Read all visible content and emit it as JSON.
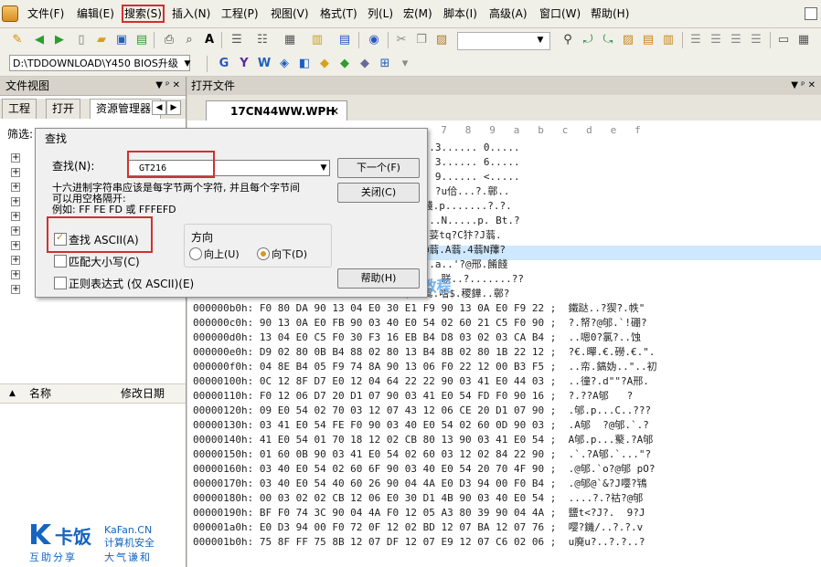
{
  "menubar": {
    "items": [
      "文件(F)",
      "编辑(E)",
      "搜索(S)",
      "插入(N)",
      "工程(P)",
      "视图(V)",
      "格式(T)",
      "列(L)",
      "宏(M)",
      "脚本(I)",
      "高级(A)",
      "窗口(W)",
      "帮助(H)"
    ]
  },
  "path": "D:\\TDDOWNLOAD\\Y450 BIOS升级",
  "left_pane": {
    "title": "文件视图",
    "pin": "▼ ᵖ ✕",
    "tabs": [
      "工程",
      "打开",
      "资源管理器"
    ],
    "filter_label": "筛选:",
    "list_header": {
      "name": "名称",
      "date": "修改日期"
    }
  },
  "right_pane": {
    "title": "打开文件",
    "pin": "▼ ᵖ ✕",
    "file_tab": "17CN44WW.WPH",
    "close": "✕"
  },
  "hex": {
    "col_header": "  7   8   9   a   b   c   d   e   f",
    "rows": [
      "         0 02 20 30 00 00 00 00 00 ;  ..3...... 0.....",
      "         0 02 20 36 00 00 00 00 00 ;  . 3...... 6.....",
      "         0 02 20 3C 00 00 00 00 00 ;  . 9...... <.....",
      "         8 1D 90 20 06 E0 90 07 01 ;  . ?u佮...?.鄣..",
      "         E 12 06 98 12 05 95 12 03 ;  餞.p.......?.?.",
      "         2 03 70 02 20 42 74 05 90 ;  :..N.....p. Bt.?",
      "         0 F0 E4 90 04 A4 F0 E4 90 ;  .荽tq?C犿?J蓊.",
      "         4 34 F0 90 04 4E F0 A3 F0 ;  @蓊.A蓊.4蓊N蘀?",
      "         3 40 E0 44 08 F0 75 8D F0 ;  ..a..'?@邢.餚餞",
      "         0 01 F0 01 5F 12 00 C0 30 8F ;  联..?.......??",
      "         0 A2 E6 90 16 02 E0 92 E2 ;  鸳.嗜$.稷鏵..鄣?",
      "000000b0h: F0 80 DA 90 13 04 E0 30 E1 F9 90 13 0A E0 F9 22 ;  鐵跶..?猰?.帙\"",
      "000000c0h: 90 13 0A E0 FB 90 03 40 E0 54 02 60 21 C5 F0 90 ;  ?.帑?@邭.`!硼?",
      "000000d0h: 13 04 E0 C5 F0 30 F3 16 EB B4 D8 03 02 03 CA B4 ;  ..嗯0?氯?..蚀",
      "000000e0h: D9 02 80 0B B4 88 02 80 13 B4 8B 02 80 1B 22 12 ;  ?€.暺.€.磱.€.\".",
      "000000f0h: 04 8E B4 05 F9 74 8A 90 13 06 F0 22 12 00 B3 F5 ;  ..帟.鎬妫..\"..初",
      "00000100h: 0C 12 8F D7 E0 12 04 64 22 22 90 03 41 E0 44 03 ;  ..徸?.d\"\"?A邢.",
      "00000110h: F0 12 06 D7 20 D1 07 90 03 41 E0 54 FD F0 90 16 ;  ?.??A邭   ?",
      "00000120h: 09 E0 54 02 70 03 12 07 43 12 06 CE 20 D1 07 90 ;  .邭.p...C..???",
      "00000130h: 03 41 E0 54 FE F0 90 03 40 E0 54 02 60 0D 90 03 ;  .A邭  ?@邭.`.?",
      "00000140h: 41 E0 54 01 70 18 12 02 CB 80 13 90 03 41 E0 54 ;  A邭.p...藂.?A邭",
      "00000150h: 01 60 0B 90 03 41 E0 54 02 60 03 12 02 84 22 90 ;  .`.?A邭.`...\"?",
      "00000160h: 03 40 E0 54 02 60 6F 90 03 40 E0 54 20 70 4F 90 ;  .@邭.`o?@邭 pO?",
      "00000170h: 03 40 E0 54 40 60 26 90 04 4A E0 D3 94 00 F0 B4 ;  .@邭@`&?J嘤?鴇",
      "00000180h: 00 03 02 02 CB 12 06 E0 30 D1 4B 90 03 40 E0 54 ;  ....?.?祜?@邭",
      "00000190h: BF F0 74 3C 90 04 4A F0 12 05 A3 80 39 90 04 4A ;  鹽t<?J?.  9?J",
      "000001a0h: E0 D3 94 00 F0 72 0F 12 02 BD 12 07 BA 12 07 76 ;  嘤?鐖/..?.?.v",
      "000001b0h: 75 8F FF 75 8B 12 07 DF 12 07 E9 12 07 C6 02 06 ;  u廃u?..?.?..?"
    ]
  },
  "find_dialog": {
    "title": "查找",
    "find_label": "查找(N):",
    "find_value": "GT216",
    "hint1": "十六进制字符串应该是每字节两个字符, 并且每个字节间",
    "hint2": "可以用空格隔开:",
    "hint3": "例如: FF FE FD 或 FFFEFD",
    "ascii_label": "查找 ASCII(A)",
    "case_label": "匹配大小写(C)",
    "regex_label": "正则表达式 (仅 ASCII)(E)",
    "direction_label": "方向",
    "up_label": "向上(U)",
    "down_label": "向下(D)",
    "next_btn": "下一个(F)",
    "close_btn": "关闭(C)",
    "help_btn": "帮助(H)",
    "ascii_checked": true,
    "direction": "down"
  },
  "watermark": "kylo原创教程",
  "logo": {
    "name": "卡饭",
    "en": "KaFan.CN",
    "tagline": "计算机安全",
    "motto1": "互助分享",
    "motto2": "大气谦和"
  },
  "colors": {
    "highlight_red": "#d23030",
    "brand_blue": "#1565c0",
    "selection": "#cde8ff"
  }
}
